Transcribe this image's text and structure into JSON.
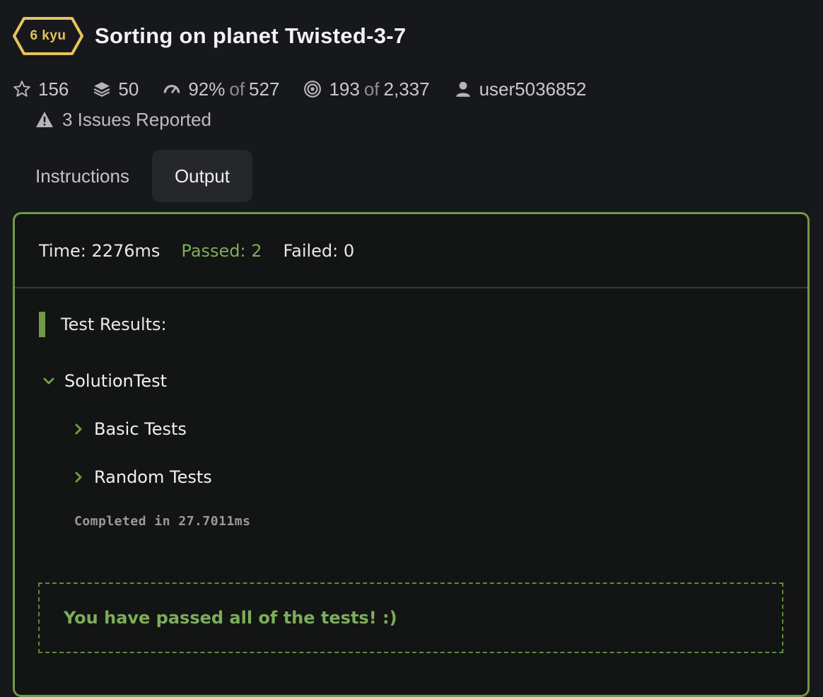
{
  "kata": {
    "rank": "6 kyu",
    "title": "Sorting on planet Twisted-3-7"
  },
  "stats": {
    "stars": "156",
    "collections": "50",
    "satisfaction_pct": "92%",
    "satisfaction_of": "of",
    "satisfaction_total": "527",
    "completed": "193",
    "completed_of": "of",
    "completed_total": "2,337",
    "author": "user5036852"
  },
  "issues": {
    "label": "3 Issues Reported"
  },
  "tabs": [
    {
      "label": "Instructions",
      "active": false
    },
    {
      "label": "Output",
      "active": true
    }
  ],
  "output": {
    "time": "Time: 2276ms",
    "passed": "Passed: 2",
    "failed": "Failed: 0",
    "results_heading": "Test Results:",
    "suite": "SolutionTest",
    "groups": [
      "Basic Tests",
      "Random Tests"
    ],
    "completed_in": "Completed in 27.7011ms",
    "pass_message": "You have passed all of the tests! :)"
  },
  "colors": {
    "background": "#17181c",
    "accent_green": "#6f9b45",
    "pass_text": "#7cad5a",
    "rank_yellow": "#e6c35b"
  },
  "icons": [
    "star-icon",
    "layers-icon",
    "gauge-icon",
    "target-icon",
    "user-icon",
    "warning-icon",
    "chevron-down-icon",
    "chevron-right-icon"
  ]
}
